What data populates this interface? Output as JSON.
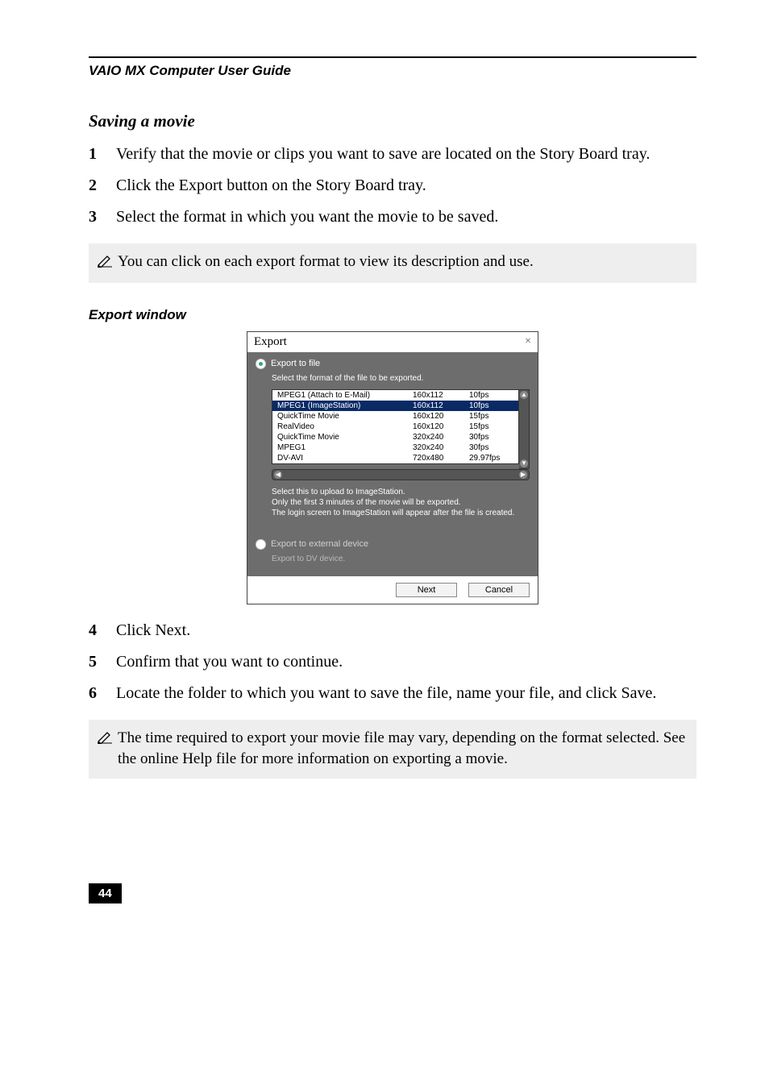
{
  "running_head": "VAIO MX Computer User Guide",
  "section_title": "Saving a movie",
  "steps_a": [
    "Verify that the movie or clips you want to save are located on the Story Board tray.",
    "Click the Export button on the Story Board tray.",
    "Select the format in which you want the movie to be saved."
  ],
  "note1": "You can click on each export format to view its description and use.",
  "subheading": "Export window",
  "dialog": {
    "title": "Export",
    "opt_file": "Export to file",
    "fmt_prompt": "Select the format of the file to be exported.",
    "formats": [
      {
        "name": "MPEG1 (Attach to E-Mail)",
        "size": "160x112",
        "fps": "10fps"
      },
      {
        "name": "MPEG1 (ImageStation)",
        "size": "160x112",
        "fps": "10fps",
        "selected": true
      },
      {
        "name": "QuickTime Movie",
        "size": "160x120",
        "fps": "15fps"
      },
      {
        "name": "RealVideo",
        "size": "160x120",
        "fps": "15fps"
      },
      {
        "name": "QuickTime Movie",
        "size": "320x240",
        "fps": "30fps"
      },
      {
        "name": "MPEG1",
        "size": "320x240",
        "fps": "30fps"
      },
      {
        "name": "DV-AVI",
        "size": "720x480",
        "fps": "29.97fps"
      }
    ],
    "desc1": "Select this to upload to ImageStation.",
    "desc2": "Only the first 3 minutes of the movie will be exported.",
    "desc3": "The login screen to ImageStation will appear after the file is created.",
    "opt_ext": "Export to external device",
    "ext_sub": "Export to DV device.",
    "next": "Next",
    "cancel": "Cancel"
  },
  "steps_b_start": 4,
  "steps_b": [
    "Click Next.",
    "Confirm that you want to continue.",
    "Locate the folder to which you want to save the file, name your file, and click Save."
  ],
  "note2": "The time required to export your movie file may vary, depending on the format selected. See the online Help file for more information on exporting a movie.",
  "page_number": "44"
}
